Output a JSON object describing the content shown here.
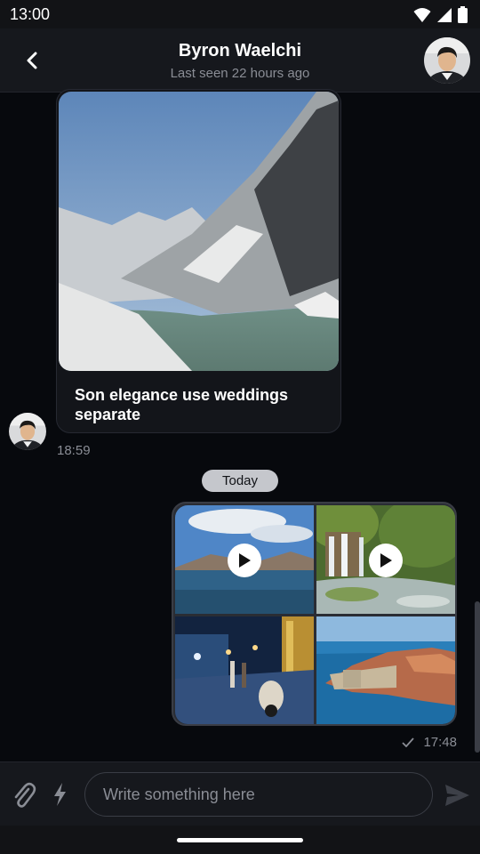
{
  "status_bar": {
    "time": "13:00",
    "icons": [
      "wifi-icon",
      "signal-icon",
      "battery-icon"
    ]
  },
  "header": {
    "contact_name": "Byron Waelchi",
    "last_seen": "Last seen 22 hours ago",
    "back_icon": "chevron-left-icon"
  },
  "messages": [
    {
      "type": "image",
      "direction": "incoming",
      "image": "snowy mountain lake",
      "caption": "Son elegance use weddings separate",
      "time": "18:59"
    },
    {
      "type": "gallery",
      "direction": "outgoing",
      "items": [
        {
          "image": "blue lake with mountains",
          "is_video": true
        },
        {
          "image": "waterfall in forest",
          "is_video": true
        },
        {
          "image": "night street with scooter",
          "is_video": false
        },
        {
          "image": "coastal walled city",
          "is_video": false
        }
      ],
      "status_icon": "check-icon",
      "time": "17:48"
    }
  ],
  "date_separator": "Today",
  "composer": {
    "placeholder": "Write something here",
    "attach_icon": "paperclip-icon",
    "bolt_icon": "lightning-icon",
    "send_icon": "send-icon"
  },
  "colors": {
    "background": "#07090d",
    "bar": "#16181d",
    "bubble": "#13151a",
    "chip": "#c5c7cc"
  }
}
